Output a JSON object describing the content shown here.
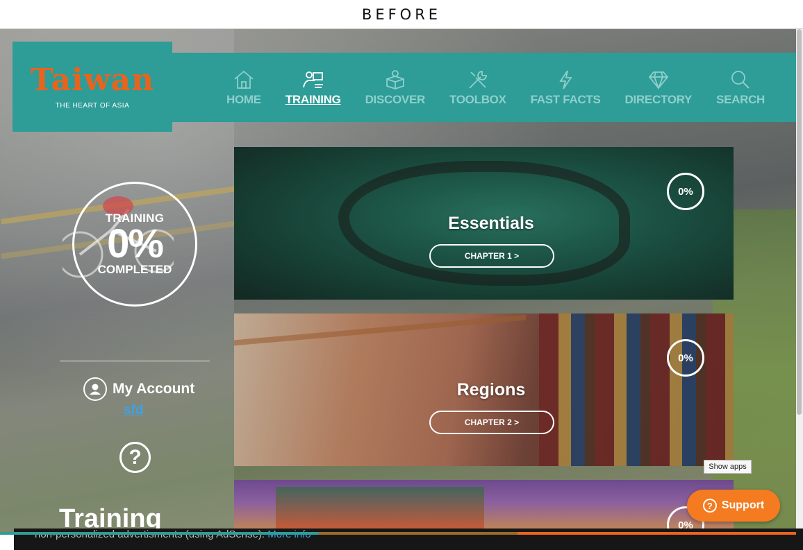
{
  "caption": "BEFORE",
  "edge_char": "k",
  "logo": {
    "word": "Taiwan",
    "tagline": "THE HEART OF ASIA"
  },
  "nav": {
    "items": [
      {
        "label": "HOME",
        "icon": "home-icon"
      },
      {
        "label": "TRAINING",
        "icon": "training-icon",
        "active": true
      },
      {
        "label": "DISCOVER",
        "icon": "discover-icon"
      },
      {
        "label": "TOOLBOX",
        "icon": "toolbox-icon"
      },
      {
        "label": "FAST FACTS",
        "icon": "lightning-icon"
      },
      {
        "label": "DIRECTORY",
        "icon": "diamond-icon"
      },
      {
        "label": "SEARCH",
        "icon": "search-icon"
      }
    ]
  },
  "progress": {
    "top": "TRAINING",
    "percent": "0%",
    "bottom": "COMPLETED"
  },
  "account": {
    "label": "My Account",
    "username": "sfd"
  },
  "help_symbol": "?",
  "side_heading": "Training",
  "chapters": [
    {
      "title": "Essentials",
      "button": "CHAPTER 1 >",
      "progress": "0%"
    },
    {
      "title": "Regions",
      "button": "CHAPTER 2 >",
      "progress": "0%"
    },
    {
      "title": "",
      "button": "",
      "progress": "0%"
    }
  ],
  "cookie": {
    "text": "non-personalized advertisments (using AdSense).",
    "link": "More info"
  },
  "show_apps": "Show apps",
  "support": {
    "label": "Support",
    "icon_char": "?"
  },
  "colors": {
    "teal": "#2e9c97",
    "orange": "#e8641e",
    "support": "#f47b20",
    "link": "#3aa3e8"
  }
}
